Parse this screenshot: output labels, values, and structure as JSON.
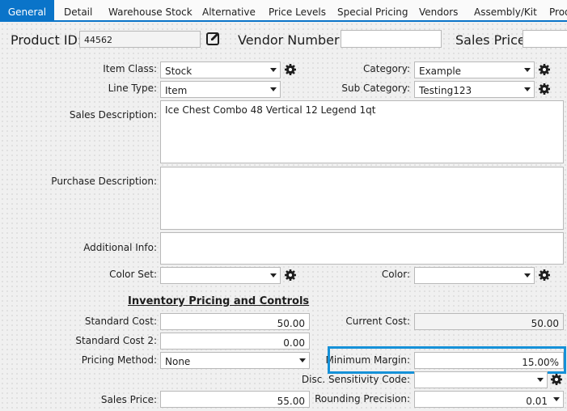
{
  "tabs": [
    "General",
    "Detail",
    "Warehouse Stock",
    "Alternative",
    "Price Levels",
    "Special Pricing",
    "Vendors",
    "Assembly/Kit",
    "Prod"
  ],
  "header": {
    "product_id_label": "Product ID:",
    "product_id_value": "44562",
    "vendor_number_label": "Vendor Number:",
    "vendor_number_value": "",
    "sales_price_label": "Sales Price:",
    "sales_price_value": ""
  },
  "fields": {
    "item_class_label": "Item Class:",
    "item_class_value": "Stock",
    "line_type_label": "Line Type:",
    "line_type_value": "Item",
    "category_label": "Category:",
    "category_value": "Example",
    "sub_category_label": "Sub Category:",
    "sub_category_value": "Testing123",
    "sales_description_label": "Sales Description:",
    "sales_description_value": "Ice Chest Combo 48 Vertical 12 Legend 1qt",
    "purchase_description_label": "Purchase Description:",
    "purchase_description_value": "",
    "additional_info_label": "Additional Info:",
    "additional_info_value": "",
    "color_set_label": "Color Set:",
    "color_set_value": "",
    "color_label": "Color:",
    "color_value": ""
  },
  "pricing": {
    "heading": "Inventory Pricing and Controls",
    "standard_cost_label": "Standard Cost:",
    "standard_cost_value": "50.00",
    "standard_cost2_label": "Standard Cost 2:",
    "standard_cost2_value": "0.00",
    "pricing_method_label": "Pricing Method:",
    "pricing_method_value": "None",
    "sales_price_label": "Sales Price:",
    "sales_price_value": "55.00",
    "current_cost_label": "Current Cost:",
    "current_cost_value": "50.00",
    "minimum_margin_label": "Minimum Margin:",
    "minimum_margin_value": "15.00%",
    "disc_sensitivity_label": "Disc. Sensitivity Code:",
    "disc_sensitivity_value": "",
    "rounding_precision_label": "Rounding Precision:",
    "rounding_precision_value": "0.01"
  },
  "icons": {
    "edit": "edit-icon",
    "gear": "gear-icon",
    "dropdown": "chevron-down-icon"
  },
  "colors": {
    "accent": "#0a74c9",
    "highlight": "#1591d8"
  }
}
